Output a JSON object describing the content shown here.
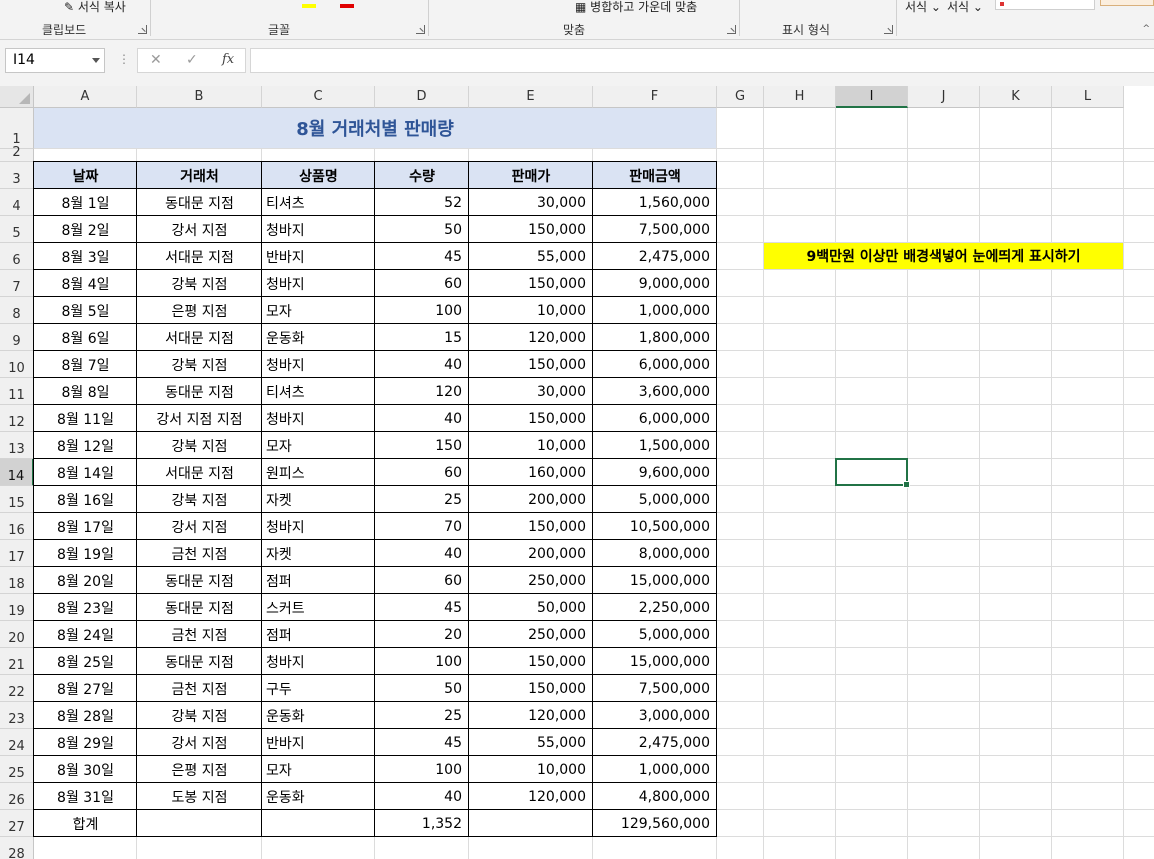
{
  "ribbon": {
    "top_items": [
      "서식 복사",
      "서식",
      "서식"
    ],
    "groups": [
      "클립보드",
      "글꼴",
      "맞춤",
      "표시 형식"
    ],
    "merge_label": "병합하고 가운데 맞춤"
  },
  "formula_bar": {
    "name_box": "I14",
    "cancel": "✕",
    "enter": "✓",
    "fx": "fx",
    "formula": ""
  },
  "columns": [
    "A",
    "B",
    "C",
    "D",
    "E",
    "F",
    "G",
    "H",
    "I",
    "J",
    "K",
    "L"
  ],
  "selected_column": "I",
  "selected_row": "14",
  "rows": [
    "1",
    "2",
    "3",
    "4",
    "5",
    "6",
    "7",
    "8",
    "9",
    "10",
    "11",
    "12",
    "13",
    "14",
    "15",
    "16",
    "17",
    "18",
    "19",
    "20",
    "21",
    "22",
    "23",
    "24",
    "25",
    "26",
    "27",
    "28"
  ],
  "sheet": {
    "title": "8월 거래처별 판매량",
    "headers": [
      "날짜",
      "거래처",
      "상품명",
      "수량",
      "판매가",
      "판매금액"
    ],
    "records": [
      [
        "8월 1일",
        "동대문 지점",
        "티셔츠",
        "52",
        "30,000",
        "1,560,000"
      ],
      [
        "8월 2일",
        "강서 지점",
        "청바지",
        "50",
        "150,000",
        "7,500,000"
      ],
      [
        "8월 3일",
        "서대문 지점",
        "반바지",
        "45",
        "55,000",
        "2,475,000"
      ],
      [
        "8월 4일",
        "강북 지점",
        "청바지",
        "60",
        "150,000",
        "9,000,000"
      ],
      [
        "8월 5일",
        "은평 지점",
        "모자",
        "100",
        "10,000",
        "1,000,000"
      ],
      [
        "8월 6일",
        "서대문 지점",
        "운동화",
        "15",
        "120,000",
        "1,800,000"
      ],
      [
        "8월 7일",
        "강북 지점",
        "청바지",
        "40",
        "150,000",
        "6,000,000"
      ],
      [
        "8월 8일",
        "동대문 지점",
        "티셔츠",
        "120",
        "30,000",
        "3,600,000"
      ],
      [
        "8월 11일",
        "강서 지점 지점",
        "청바지",
        "40",
        "150,000",
        "6,000,000"
      ],
      [
        "8월 12일",
        "강북 지점",
        "모자",
        "150",
        "10,000",
        "1,500,000"
      ],
      [
        "8월 14일",
        "서대문 지점",
        "원피스",
        "60",
        "160,000",
        "9,600,000"
      ],
      [
        "8월 16일",
        "강북 지점",
        "자켓",
        "25",
        "200,000",
        "5,000,000"
      ],
      [
        "8월 17일",
        "강서 지점",
        "청바지",
        "70",
        "150,000",
        "10,500,000"
      ],
      [
        "8월 19일",
        "금천 지점",
        "자켓",
        "40",
        "200,000",
        "8,000,000"
      ],
      [
        "8월 20일",
        "동대문 지점",
        "점퍼",
        "60",
        "250,000",
        "15,000,000"
      ],
      [
        "8월 23일",
        "동대문 지점",
        "스커트",
        "45",
        "50,000",
        "2,250,000"
      ],
      [
        "8월 24일",
        "금천 지점",
        "점퍼",
        "20",
        "250,000",
        "5,000,000"
      ],
      [
        "8월 25일",
        "동대문 지점",
        "청바지",
        "100",
        "150,000",
        "15,000,000"
      ],
      [
        "8월 27일",
        "금천 지점",
        "구두",
        "50",
        "150,000",
        "7,500,000"
      ],
      [
        "8월 28일",
        "강북 지점",
        "운동화",
        "25",
        "120,000",
        "3,000,000"
      ],
      [
        "8월 29일",
        "강서 지점",
        "반바지",
        "45",
        "55,000",
        "2,475,000"
      ],
      [
        "8월 30일",
        "은평 지점",
        "모자",
        "100",
        "10,000",
        "1,000,000"
      ],
      [
        "8월 31일",
        "도봉 지점",
        "운동화",
        "40",
        "120,000",
        "4,800,000"
      ]
    ],
    "total": [
      "합계",
      "",
      "",
      "1,352",
      "",
      "129,560,000"
    ],
    "note": "9백만원 이상만 배경색넣어 눈에띄게 표시하기"
  },
  "colors": {
    "title_fill": "#dae3f3",
    "title_text": "#2f5597",
    "note_fill": "#ffff00",
    "selection": "#217346"
  }
}
